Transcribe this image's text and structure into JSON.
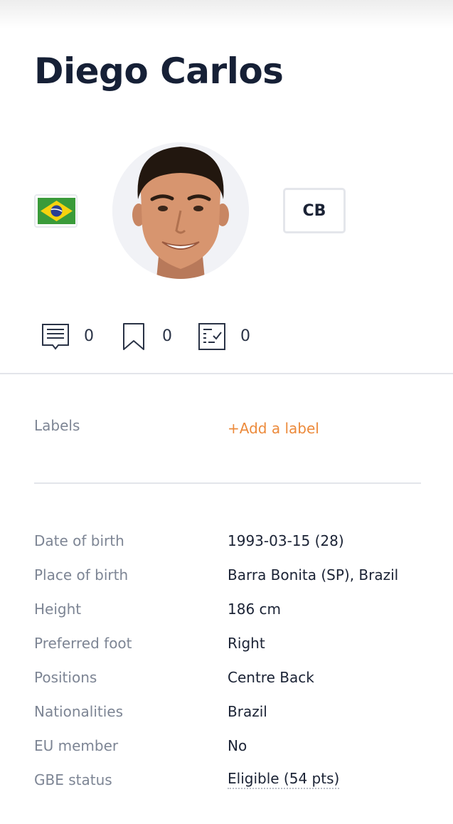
{
  "player": {
    "name": "Diego Carlos",
    "position": "CB",
    "flag_icon": "brazil-flag-icon",
    "avatar_icon": "player-photo"
  },
  "stats": [
    {
      "icon": "comments-icon",
      "count": "0"
    },
    {
      "icon": "bookmark-icon",
      "count": "0"
    },
    {
      "icon": "checklist-icon",
      "count": "0"
    }
  ],
  "labels": {
    "title": "Labels",
    "add_label": "+Add a label"
  },
  "details": [
    {
      "key": "Date of birth",
      "value": "1993-03-15 (28)"
    },
    {
      "key": "Place of birth",
      "value": "Barra Bonita (SP), Brazil"
    },
    {
      "key": "Height",
      "value": "186 cm"
    },
    {
      "key": "Preferred foot",
      "value": "Right"
    },
    {
      "key": "Positions",
      "value": "Centre Back"
    },
    {
      "key": "Nationalities",
      "value": "Brazil"
    },
    {
      "key": "EU member",
      "value": "No"
    },
    {
      "key": "GBE status",
      "value": "Eligible (54 pts)"
    }
  ],
  "colors": {
    "accent": "#ec8a3b",
    "text": "#1b2335",
    "muted": "#7d8594",
    "divider": "#e3e5ea"
  }
}
